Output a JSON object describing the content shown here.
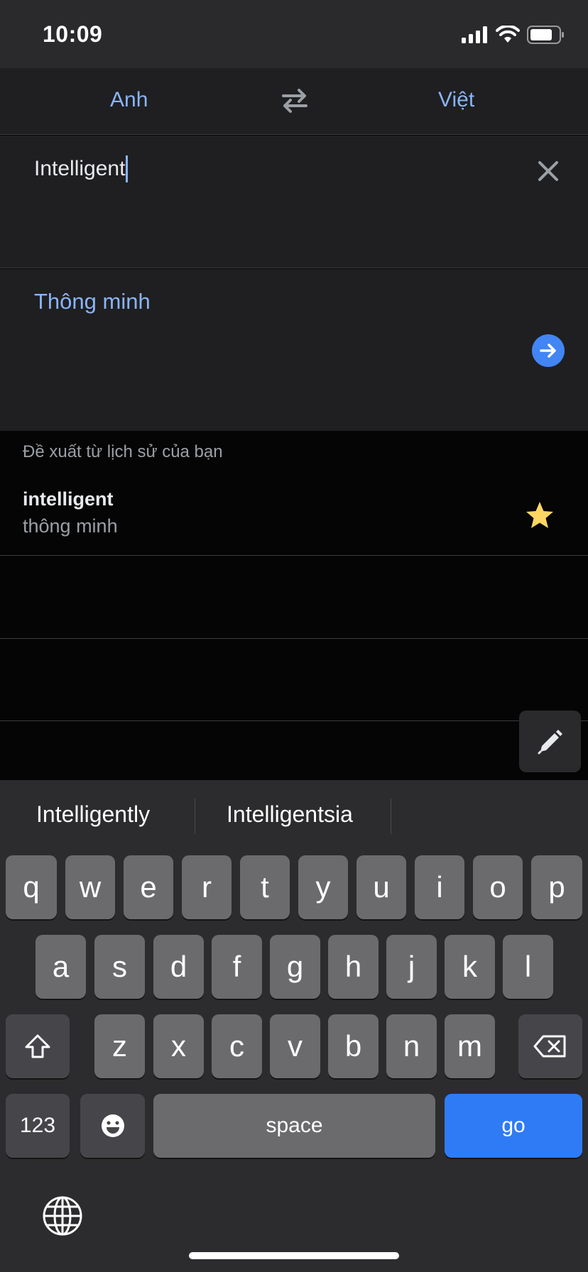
{
  "status_bar": {
    "time": "10:09",
    "icons": [
      "signal-icon",
      "wifi-icon",
      "battery-icon"
    ]
  },
  "languages": {
    "source": "Anh",
    "target": "Việt",
    "swap_icon": "swap-arrows-icon"
  },
  "input": {
    "text": "Intelligent",
    "clear_icon": "close-icon"
  },
  "output": {
    "text": "Thông minh",
    "go_icon": "arrow-right-icon"
  },
  "suggestions": {
    "header": "Đề xuất từ lịch sử của bạn",
    "items": [
      {
        "source": "intelligent",
        "target": "thông minh",
        "starred": true
      }
    ]
  },
  "handwriting_icon": "pen-icon",
  "keyboard": {
    "predictions": [
      "Intelligently",
      "Intelligentsia",
      ""
    ],
    "row1": [
      "q",
      "w",
      "e",
      "r",
      "t",
      "y",
      "u",
      "i",
      "o",
      "p"
    ],
    "row2": [
      "a",
      "s",
      "d",
      "f",
      "g",
      "h",
      "j",
      "k",
      "l"
    ],
    "row3": [
      "z",
      "x",
      "c",
      "v",
      "b",
      "n",
      "m"
    ],
    "numbers_label": "123",
    "space_label": "space",
    "go_label": "go",
    "shift_icon": "shift-icon",
    "delete_icon": "backspace-icon",
    "emoji_icon": "emoji-icon",
    "globe_icon": "globe-icon"
  },
  "colors": {
    "accent": "#8ab4f8",
    "go_key": "#2f7bf6",
    "star": "#fdd663",
    "arrow_button": "#4285f4"
  }
}
